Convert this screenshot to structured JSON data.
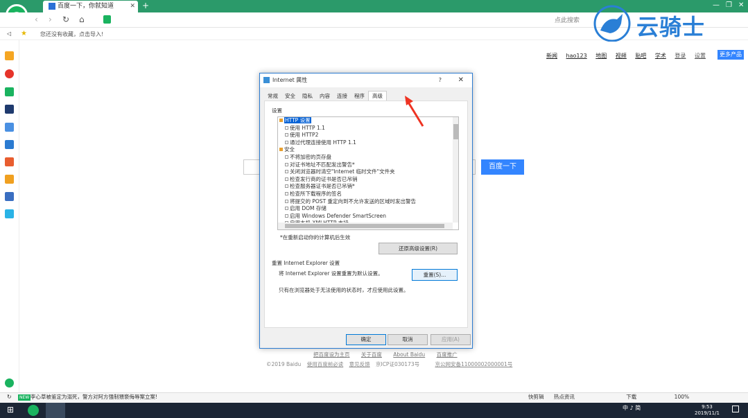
{
  "browser": {
    "tab_title": "百度一下，你就知道",
    "new_tab": "+",
    "search_right": "点此搜索",
    "fav_prompt": "您还没有收藏，点击导入!"
  },
  "baidu": {
    "top_links": [
      "新闻",
      "hao123",
      "地图",
      "视频",
      "贴吧",
      "学术",
      "登录",
      "设置"
    ],
    "more_products": "更多产品",
    "search_button": "百度一下",
    "footer_links": [
      "把百度设为主页",
      "关于百度",
      "About Baidu",
      "百度推广"
    ],
    "footer_line2": [
      "©2019 Baidu",
      "使用百度前必读",
      "意见反馈",
      "京ICP证030173号",
      "京公网安备11000002000001号"
    ]
  },
  "dialog": {
    "title": "Internet 属性",
    "help": "?",
    "close": "✕",
    "tabs": [
      "常规",
      "安全",
      "隐私",
      "内容",
      "连接",
      "程序",
      "高级"
    ],
    "settings_label": "设置",
    "tree": [
      {
        "text": "HTTP 设置",
        "header": true,
        "selected": true
      },
      {
        "text": "使用 HTTP 1.1"
      },
      {
        "text": "使用 HTTP2"
      },
      {
        "text": "通过代理连接使用 HTTP 1.1"
      },
      {
        "text": "安全",
        "header": true
      },
      {
        "text": "不将加密的页存盘"
      },
      {
        "text": "对证书地址不匹配发出警告*"
      },
      {
        "text": "关闭浏览器时清空\"Internet 临时文件\"文件夹"
      },
      {
        "text": "检查发行商的证书是否已吊销"
      },
      {
        "text": "检查服务器证书是否已吊销*"
      },
      {
        "text": "检查所下载程序的签名"
      },
      {
        "text": "将提交的 POST 重定向到不允许发送的区域时发出警告"
      },
      {
        "text": "启用 DOM 存储"
      },
      {
        "text": "启用 Windows Defender SmartScreen"
      },
      {
        "text": "启用本机 XMLHTTP 支持"
      }
    ],
    "note": "*在重新启动你的计算机后生效",
    "restore_button": "还原高级设置(R)",
    "reset_title": "重置 Internet Explorer 设置",
    "reset_desc": "将 Internet Explorer 设置重置为默认设置。",
    "reset_button": "重置(S)...",
    "reset_note": "只有在浏览器处于无法使用的状态时，才应使用此设置。",
    "ok": "确定",
    "cancel": "取消",
    "apply": "应用(A)"
  },
  "watermark": "云骑士",
  "statusbar": {
    "news_badge": "NEW",
    "news": "李心草被鉴定为溺死，警方对阿方强制猥亵侮辱案立案!",
    "items": [
      "快剪辑",
      "热点资讯",
      "下载",
      "100%"
    ]
  },
  "taskbar": {
    "tray": "中 ♪ 简",
    "time": "9:53",
    "date": "2019/11/1"
  },
  "colors": {
    "accent": "#3385ff",
    "tabbar": "#2b9a6a",
    "dialog_border": "#2b7bd1"
  }
}
